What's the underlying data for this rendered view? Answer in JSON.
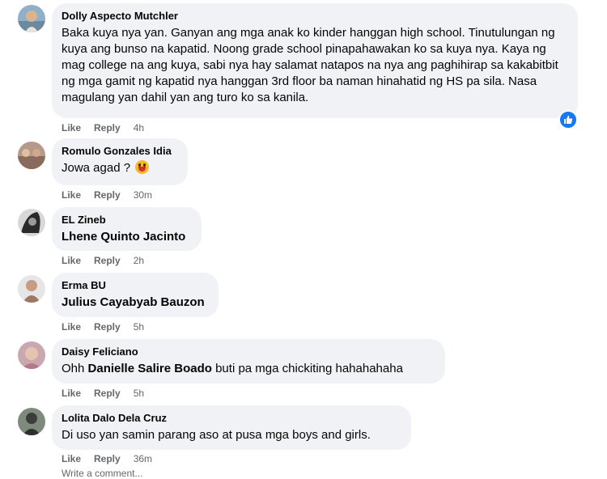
{
  "comments": [
    {
      "author": "Dolly Aspecto Mutchler",
      "text": "Baka kuya nya yan. Ganyan ang mga anak ko kinder hanggan high school. Tinutulungan ng kuya ang bunso na kapatid. Noong grade school pinapahawakan ko sa kuya nya. Kaya ng mag college na ang kuya, sabi nya hay salamat natapos na nya ang paghihirap sa kakabitbit ng mga gamit ng kapatid nya hanggan 3rd floor ba naman hinahatid ng HS pa sila. Nasa magulang yan dahil yan ang turo ko sa kanila.",
      "like": "Like",
      "reply": "Reply",
      "time": "4h"
    },
    {
      "author": "Romulo Gonzales Idia",
      "text": "Jowa agad ? ",
      "like": "Like",
      "reply": "Reply",
      "time": "30m"
    },
    {
      "author": "EL Zineb",
      "text": "Lhene Quinto Jacinto",
      "like": "Like",
      "reply": "Reply",
      "time": "2h"
    },
    {
      "author": "Erma BU",
      "text": "Julius Cayabyab Bauzon",
      "like": "Like",
      "reply": "Reply",
      "time": "5h"
    },
    {
      "author": "Daisy Feliciano",
      "text_before": "Ohh ",
      "mention": "Danielle Salire Boado",
      "text_after": " buti pa mga chickiting hahahahaha",
      "like": "Like",
      "reply": "Reply",
      "time": "5h"
    },
    {
      "author": "Lolita Dalo Dela Cruz",
      "text": "Di uso yan samin parang aso at pusa mga boys and girls.",
      "like": "Like",
      "reply": "Reply",
      "time": "36m"
    }
  ],
  "write_comment_placeholder": "Write a comment...",
  "colors": {
    "bubble": "#f0f2f5",
    "meta_text": "#65676b",
    "like_blue": "#1877f2"
  },
  "icons": {
    "reaction_badge": "thumbs-up-icon",
    "emoji": "laughing-emoji-icon"
  }
}
